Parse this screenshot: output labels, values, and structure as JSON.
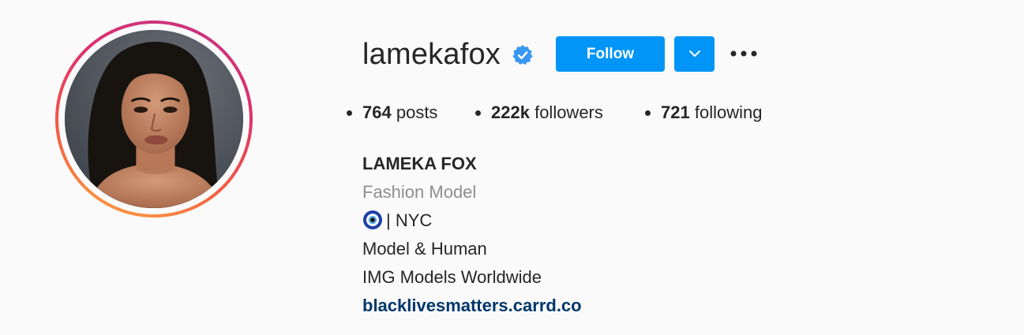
{
  "profile": {
    "username": "lamekafox",
    "verified_icon": "verified-badge-icon",
    "follow_label": "Follow",
    "dropdown_icon": "chevron-down-icon",
    "more_icon": "more-horizontal-icon"
  },
  "stats": {
    "posts_count": "764",
    "posts_label": "posts",
    "followers_count": "222k",
    "followers_label": "followers",
    "following_count": "721",
    "following_label": "following"
  },
  "bio": {
    "name": "LAMEKA FOX",
    "category": "Fashion Model",
    "location_line": "| NYC",
    "line_1": "Model & Human",
    "line_2": "IMG Models Worldwide",
    "link": "blacklivesmatters.carrd.co"
  },
  "colors": {
    "accent": "#0095f6",
    "link": "#00376b",
    "muted": "#8e8e8e",
    "ring_start": "#c13584",
    "ring_end": "#fcaf45"
  }
}
